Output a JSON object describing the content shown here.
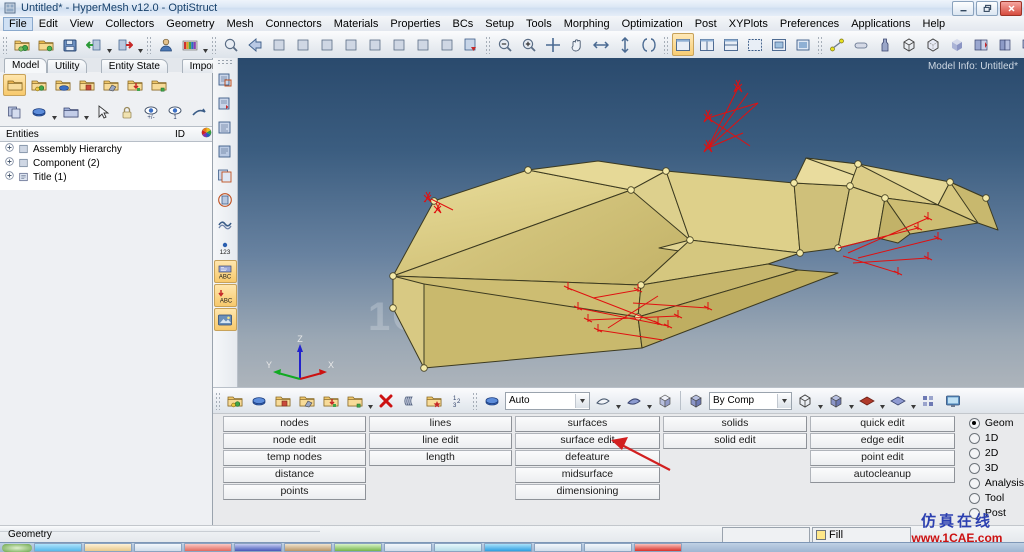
{
  "window": {
    "title": "Untitled* - HyperMesh v12.0 - OptiStruct",
    "icon": "application-icon",
    "controls": [
      {
        "name": "minimize-button",
        "glyph": "minimize-icon"
      },
      {
        "name": "restore-button",
        "glyph": "restore-icon"
      },
      {
        "name": "close-button",
        "glyph": "close-icon"
      }
    ]
  },
  "menubar": {
    "items": [
      {
        "label": "File",
        "active": true
      },
      {
        "label": "Edit",
        "active": false
      },
      {
        "label": "View",
        "active": false
      },
      {
        "label": "Collectors",
        "active": false
      },
      {
        "label": "Geometry",
        "active": false
      },
      {
        "label": "Mesh",
        "active": false
      },
      {
        "label": "Connectors",
        "active": false
      },
      {
        "label": "Materials",
        "active": false
      },
      {
        "label": "Properties",
        "active": false
      },
      {
        "label": "BCs",
        "active": false
      },
      {
        "label": "Setup",
        "active": false
      },
      {
        "label": "Tools",
        "active": false
      },
      {
        "label": "Morphing",
        "active": false
      },
      {
        "label": "Optimization",
        "active": false
      },
      {
        "label": "Post",
        "active": false
      },
      {
        "label": "XYPlots",
        "active": false
      },
      {
        "label": "Preferences",
        "active": false
      },
      {
        "label": "Applications",
        "active": false
      },
      {
        "label": "Help",
        "active": false
      }
    ]
  },
  "toolbar": {
    "groups": [
      {
        "name": "file-group",
        "buttons": [
          {
            "name": "open-model-icon",
            "type": "folder-green"
          },
          {
            "name": "import-model-icon",
            "type": "folder-yellow"
          },
          {
            "name": "save-model-icon",
            "type": "floppy"
          },
          {
            "name": "import-geometry-icon",
            "type": "arrow-green-in",
            "split": true
          },
          {
            "name": "export-geometry-icon",
            "type": "arrow-red-out",
            "split": true
          }
        ]
      },
      {
        "name": "session-group",
        "buttons": [
          {
            "name": "user-profile-icon",
            "type": "person"
          },
          {
            "name": "color-palette-icon",
            "type": "palette",
            "split": true
          }
        ]
      },
      {
        "name": "view-group",
        "buttons": [
          {
            "name": "fit-view-icon",
            "type": "magnifier-fit"
          },
          {
            "name": "previous-view-icon",
            "type": "arrow-left"
          },
          {
            "name": "view-xy-icon",
            "type": "axis-yx"
          },
          {
            "name": "view-yx-icon",
            "type": "axis-rx"
          },
          {
            "name": "view-zx-icon",
            "type": "axis-zx"
          },
          {
            "name": "view-xz-icon",
            "type": "axis-xz"
          },
          {
            "name": "view-zy-icon",
            "type": "axis-zy"
          },
          {
            "name": "view-yz-icon",
            "type": "axis-yz"
          },
          {
            "name": "view-iso-icon",
            "type": "axis-iso"
          },
          {
            "name": "view-rotate-icon",
            "type": "axis-rot"
          },
          {
            "name": "view-flip-icon",
            "type": "page-flip"
          }
        ]
      },
      {
        "name": "navigate-group",
        "buttons": [
          {
            "name": "zoom-out-icon",
            "type": "magnifier-minus"
          },
          {
            "name": "zoom-in-icon",
            "type": "magnifier-plus"
          },
          {
            "name": "center-icon",
            "type": "crosshair"
          },
          {
            "name": "pan-icon",
            "type": "hand"
          },
          {
            "name": "zoom-horizontal-icon",
            "type": "arrows-h"
          },
          {
            "name": "zoom-vertical-icon",
            "type": "arrows-v"
          },
          {
            "name": "circle-zoom-icon",
            "type": "braces"
          }
        ]
      },
      {
        "name": "window-group",
        "buttons": [
          {
            "name": "single-window-icon",
            "type": "win1",
            "selected": true
          },
          {
            "name": "two-window-icon",
            "type": "win2"
          },
          {
            "name": "three-window-icon",
            "type": "win3"
          },
          {
            "name": "four-window-icon",
            "type": "win4"
          },
          {
            "name": "tile-window-icon",
            "type": "win5"
          },
          {
            "name": "capture-window-icon",
            "type": "win6"
          }
        ]
      },
      {
        "name": "measure-group",
        "buttons": [
          {
            "name": "distance-icon",
            "type": "dist"
          },
          {
            "name": "mass-calc-icon",
            "type": "capsule"
          },
          {
            "name": "mass-details-icon",
            "type": "bottle"
          },
          {
            "name": "wireframe-icon",
            "type": "cube-wire"
          },
          {
            "name": "hidden-line-icon",
            "type": "cube-hidden"
          },
          {
            "name": "shaded-icon",
            "type": "cube-shaded"
          },
          {
            "name": "section-cut-icon",
            "type": "book-red"
          },
          {
            "name": "mesh-lines-icon",
            "type": "book-blue"
          },
          {
            "name": "contour-icon",
            "type": "book-arrow"
          },
          {
            "name": "summary-icon",
            "type": "sigma"
          },
          {
            "name": "summary-alt-icon",
            "type": "sigma-alt"
          },
          {
            "name": "matrix-icon",
            "type": "grid"
          }
        ]
      }
    ]
  },
  "leftpanel": {
    "tabs": [
      {
        "label": "Model",
        "active": true
      },
      {
        "label": "Utility",
        "active": false
      },
      {
        "label": "Entity State",
        "active": false
      },
      {
        "label": "Import",
        "active": false
      }
    ],
    "close_glyph": "✕",
    "toolrow1": [
      {
        "name": "new-collector-icon",
        "type": "folder-plain",
        "selected": true
      },
      {
        "name": "assembly-icon",
        "type": "folder-assembly"
      },
      {
        "name": "component-icon",
        "type": "folder-component"
      },
      {
        "name": "property-icon",
        "type": "folder-property"
      },
      {
        "name": "material-icon",
        "type": "folder-material"
      },
      {
        "name": "load-collector-icon",
        "type": "folder-load"
      },
      {
        "name": "system-collector-icon",
        "type": "folder-system"
      }
    ],
    "toolrow2": [
      {
        "name": "display-all-icon",
        "type": "pages"
      },
      {
        "name": "display-component-icon",
        "type": "blue-disc",
        "split": true
      },
      {
        "name": "display-assembly-icon",
        "type": "pages-blue",
        "split": true
      },
      {
        "name": "select-pointer-icon",
        "type": "cursor"
      },
      {
        "name": "lock-icon",
        "type": "padlock"
      },
      {
        "name": "show-hide-icon",
        "type": "eye-plusminus"
      },
      {
        "name": "isolate-icon",
        "type": "eye-one"
      },
      {
        "name": "reverse-icon",
        "type": "swoosh"
      }
    ],
    "tree": {
      "columns": [
        "Entities",
        "ID",
        "color-wheel-icon"
      ],
      "rows": [
        {
          "label": "Assembly Hierarchy",
          "icon": "assembly-icon",
          "expandable": true
        },
        {
          "label": "Component (2)",
          "icon": "component-icon",
          "expandable": true
        },
        {
          "label": "Title (1)",
          "icon": "title-icon",
          "expandable": true
        }
      ]
    }
  },
  "viewport": {
    "model_info": "Model Info: Untitled*",
    "watermark": "1CAE.COM",
    "background_top": "#2a4a6d",
    "background_bottom": "#adb4bb",
    "surface_color": "#ded08a",
    "surface_color_dark": "#b8a85e",
    "marker_color": "#e01010",
    "axes": [
      {
        "label": "Z",
        "color": "#2222cc"
      },
      {
        "label": "X",
        "color": "#cc1111"
      },
      {
        "label": "Y",
        "color": "#11aa22"
      }
    ],
    "vtoolbar": [
      {
        "name": "page-new-icon",
        "type": "page-new"
      },
      {
        "name": "page-delete-icon",
        "type": "page-del"
      },
      {
        "name": "page-next-icon",
        "type": "page-next"
      },
      {
        "name": "page-prev-icon",
        "type": "page-prev"
      },
      {
        "name": "page-copy-icon",
        "type": "page-copy"
      },
      {
        "name": "page-circle-icon",
        "type": "page-circle"
      },
      {
        "name": "mask-icon",
        "type": "mask"
      },
      {
        "name": "numbers-icon",
        "type": "numbers"
      },
      {
        "name": "abc-label-icon",
        "type": "abc1",
        "selected": true
      },
      {
        "name": "abc-note-icon",
        "type": "abc2",
        "selected": true
      },
      {
        "name": "image-capture-icon",
        "type": "imgcap",
        "selected": true
      }
    ]
  },
  "graphics_toolbar": {
    "left_buttons": [
      {
        "name": "assembly-display-icon",
        "type": "folder-assembly"
      },
      {
        "name": "component-display-icon",
        "type": "blue-disc-folder"
      },
      {
        "name": "property-display-icon",
        "type": "folder-property"
      },
      {
        "name": "material-display-icon",
        "type": "folder-material"
      },
      {
        "name": "load-display-icon",
        "type": "folder-load"
      },
      {
        "name": "system-display-icon",
        "type": "folder-system",
        "split": true
      },
      {
        "name": "delete-icon",
        "type": "red-x"
      },
      {
        "name": "organize-icon",
        "type": "stack"
      },
      {
        "name": "renumber-icon",
        "type": "folder-star"
      },
      {
        "name": "reorder-icon",
        "type": "numbers123"
      }
    ],
    "mesh_mode": {
      "name": "mesh-mode-combo",
      "value": "Auto"
    },
    "mid_buttons": [
      {
        "name": "shrink-element-icon",
        "type": "shell-outline",
        "split": true
      },
      {
        "name": "element-normals-icon",
        "type": "shell-blue",
        "split": true
      },
      {
        "name": "solid-display-icon",
        "type": "cube-iso"
      }
    ],
    "color_mode": {
      "name": "color-mode-combo",
      "value": "By Comp"
    },
    "right_buttons": [
      {
        "name": "wireframe-display-icon",
        "type": "cube-wire",
        "split": true
      },
      {
        "name": "hidden-line-display-icon",
        "type": "cube-solid",
        "split": true
      },
      {
        "name": "shaded-edges-icon",
        "type": "diamond-red",
        "split": true
      },
      {
        "name": "shaded-display-icon",
        "type": "diamond-blue",
        "split": true
      },
      {
        "name": "element-size-icon",
        "type": "squares"
      },
      {
        "name": "graphics-settings-icon",
        "type": "monitor"
      }
    ]
  },
  "command_panel": {
    "columns": [
      {
        "name": "column-nodes",
        "buttons": [
          "nodes",
          "node edit",
          "temp nodes",
          "distance",
          "points"
        ]
      },
      {
        "name": "column-lines",
        "buttons": [
          "lines",
          "line edit",
          "length"
        ]
      },
      {
        "name": "column-surfaces",
        "buttons": [
          "surfaces",
          "surface edit",
          "defeature",
          "midsurface",
          "dimensioning"
        ]
      },
      {
        "name": "column-solids",
        "buttons": [
          "solids",
          "solid edit"
        ]
      },
      {
        "name": "column-edit",
        "buttons": [
          "quick edit",
          "edge edit",
          "point edit",
          "autocleanup"
        ]
      }
    ],
    "modes": [
      {
        "label": "Geom",
        "selected": true
      },
      {
        "label": "1D",
        "selected": false
      },
      {
        "label": "2D",
        "selected": false
      },
      {
        "label": "3D",
        "selected": false
      },
      {
        "label": "Analysis",
        "selected": false
      },
      {
        "label": "Tool",
        "selected": false
      },
      {
        "label": "Post",
        "selected": false
      }
    ],
    "annotation_arrow": {
      "name": "callout-arrow",
      "color": "#d22020",
      "points_to": "surface edit"
    }
  },
  "statusbar": {
    "message": "Geometry",
    "field_value": "",
    "fill_label": "Fill"
  },
  "site_watermark": {
    "line1": "仿真在线",
    "line2": "www.1CAE.com"
  }
}
